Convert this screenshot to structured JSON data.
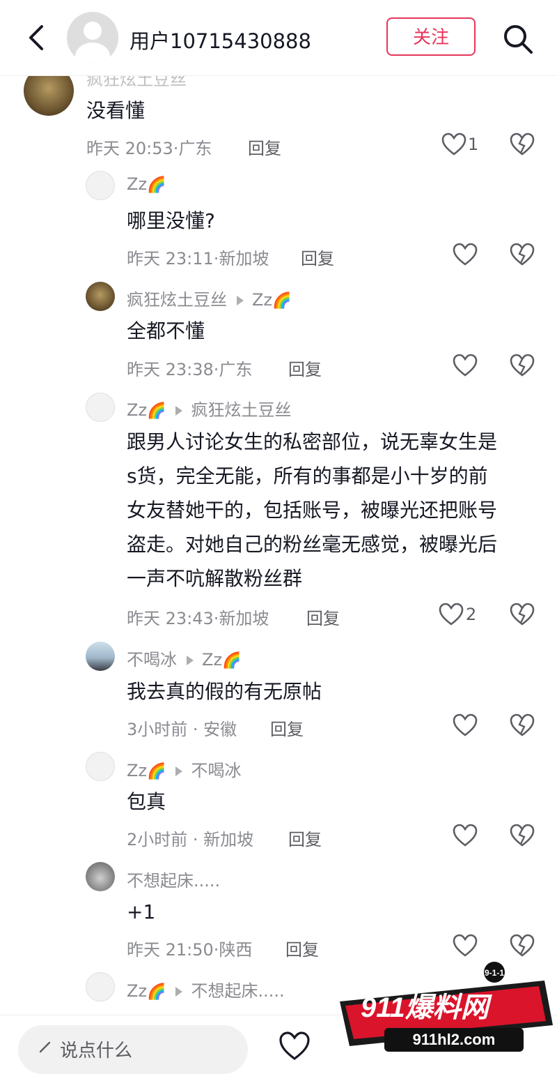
{
  "header": {
    "title": "用户10715430888",
    "follow_label": "关注"
  },
  "comments": [
    {
      "name": "疯狂炫土豆丝",
      "text": "没看懂",
      "time": "昨天 20:53",
      "loc": "广东",
      "reply_label": "回复",
      "likes": "1"
    },
    {
      "name": "Zz",
      "text": "哪里没懂?",
      "time": "昨天 23:11",
      "loc": "新加坡",
      "reply_label": "回复",
      "likes": ""
    },
    {
      "name": "疯狂炫土豆丝",
      "target": "Zz",
      "text": "全都不懂",
      "time": "昨天 23:38",
      "loc": "广东",
      "reply_label": "回复",
      "likes": ""
    },
    {
      "name": "Zz",
      "target": "疯狂炫土豆丝",
      "lines": [
        "跟男人讨论女生的私密部位，说无辜女生是",
        "s货，完全无能，所有的事都是小十岁的前",
        "女友替她干的，包括账号，被曝光还把账号",
        "盗走。对她自己的粉丝毫无感觉，被曝光后",
        "一声不吭解散粉丝群"
      ],
      "time": "昨天 23:43",
      "loc": "新加坡",
      "reply_label": "回复",
      "likes": "2"
    },
    {
      "name": "不喝冰",
      "target": "Zz",
      "text": "我去真的假的有无原帖",
      "time": "3小时前",
      "loc": "安徽",
      "reply_label": "回复",
      "likes": ""
    },
    {
      "name": "Zz",
      "target": "不喝冰",
      "text": "包真",
      "time": "2小时前",
      "loc": "新加坡",
      "reply_label": "回复",
      "likes": ""
    },
    {
      "name": "不想起床.....",
      "text": "+1",
      "time": "昨天 21:50",
      "loc": "陕西",
      "reply_label": "回复",
      "likes": ""
    },
    {
      "name": "Zz",
      "target": "不想起床....."
    }
  ],
  "bottom": {
    "placeholder": "说点什么"
  },
  "watermark": {
    "badge": "9-1-1",
    "brand": "911爆料网",
    "url": "911hl2.com"
  },
  "colors": {
    "accent": "#e8355a"
  }
}
